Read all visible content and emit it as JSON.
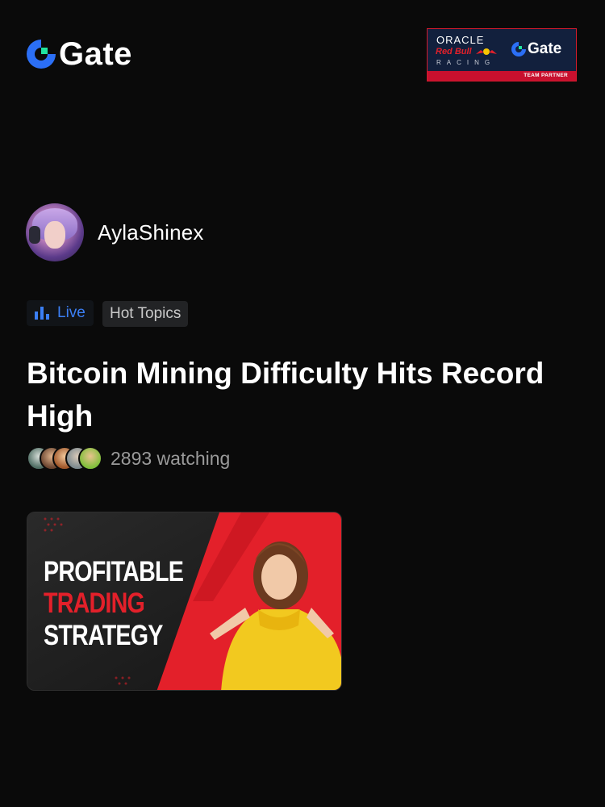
{
  "header": {
    "logo_text": "Gate",
    "brand_color": "#2b6ff6",
    "partner": {
      "oracle": "ORACLE",
      "red_bull": "Red Bull",
      "racing": "RACING",
      "gate": "Gate",
      "footer": "TEAM PARTNER"
    }
  },
  "user": {
    "name": "AylaShinex"
  },
  "tags": {
    "live": "Live",
    "topic": "Hot Topics"
  },
  "post": {
    "title": "Bitcoin Mining Difficulty Hits Record High",
    "watching": "2893 watching"
  },
  "thumbnail": {
    "line1": "PROFITABLE",
    "line2": "TRADING",
    "line3": "STRATEGY"
  },
  "colors": {
    "background": "#0a0a0a",
    "live_accent": "#3b7ff5",
    "thumbnail_red": "#e3202a",
    "muted_text": "#9a9a9a"
  }
}
